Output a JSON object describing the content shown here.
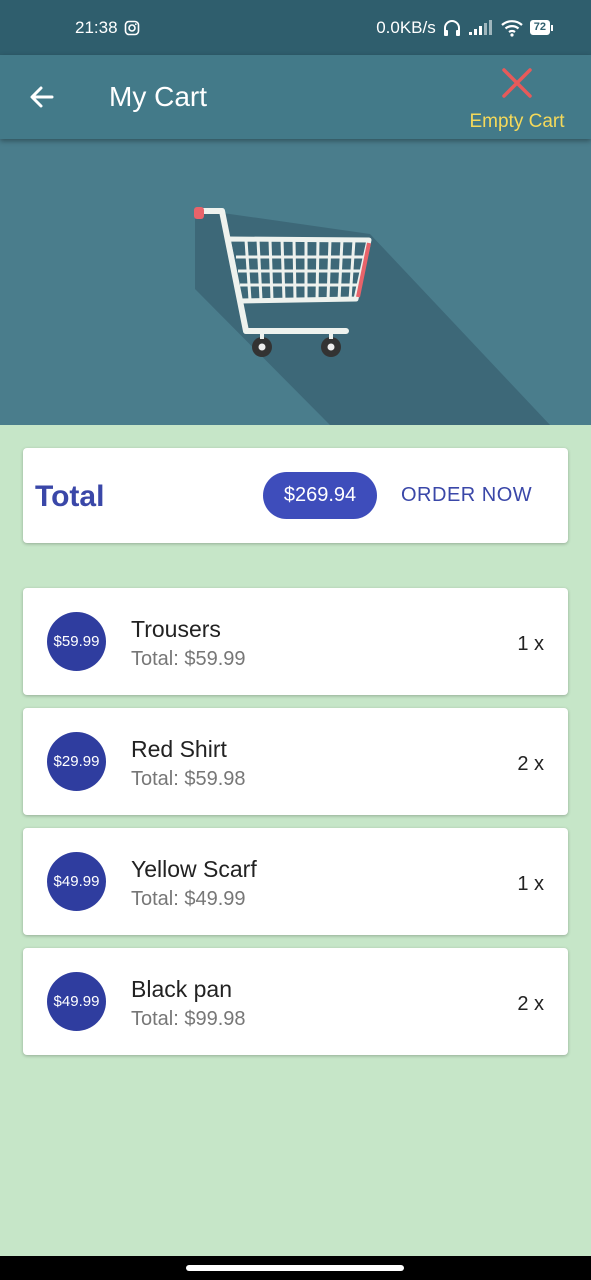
{
  "status_bar": {
    "time": "21:38",
    "network_speed": "0.0KB/s",
    "battery": "72",
    "icons": [
      "instagram-icon",
      "headphones-icon",
      "signal-icon",
      "wifi-icon",
      "battery-icon"
    ]
  },
  "app_bar": {
    "title": "My Cart",
    "empty_cart_label": "Empty Cart",
    "icons": {
      "back": "arrow-left-icon",
      "empty": "close-icon"
    }
  },
  "summary": {
    "label": "Total",
    "amount": "$269.94",
    "order_label": "ORDER NOW"
  },
  "items": [
    {
      "badge": "$59.99",
      "name": "Trousers",
      "total": "Total: $59.99",
      "qty": "1 x"
    },
    {
      "badge": "$29.99",
      "name": "Red Shirt",
      "total": "Total: $59.98",
      "qty": "2 x"
    },
    {
      "badge": "$49.99",
      "name": "Yellow Scarf",
      "total": "Total: $49.99",
      "qty": "1 x"
    },
    {
      "badge": "$49.99",
      "name": "Black pan",
      "total": "Total: $99.98",
      "qty": "2 x"
    }
  ],
  "colors": {
    "status_bar": "#2f5e6d",
    "app_bar": "#437a89",
    "hero": "#4a7d8c",
    "background": "#c6e6c8",
    "accent": "#3e4dbb",
    "empty_cart": "#f5d95a",
    "close": "#e75a5a"
  }
}
